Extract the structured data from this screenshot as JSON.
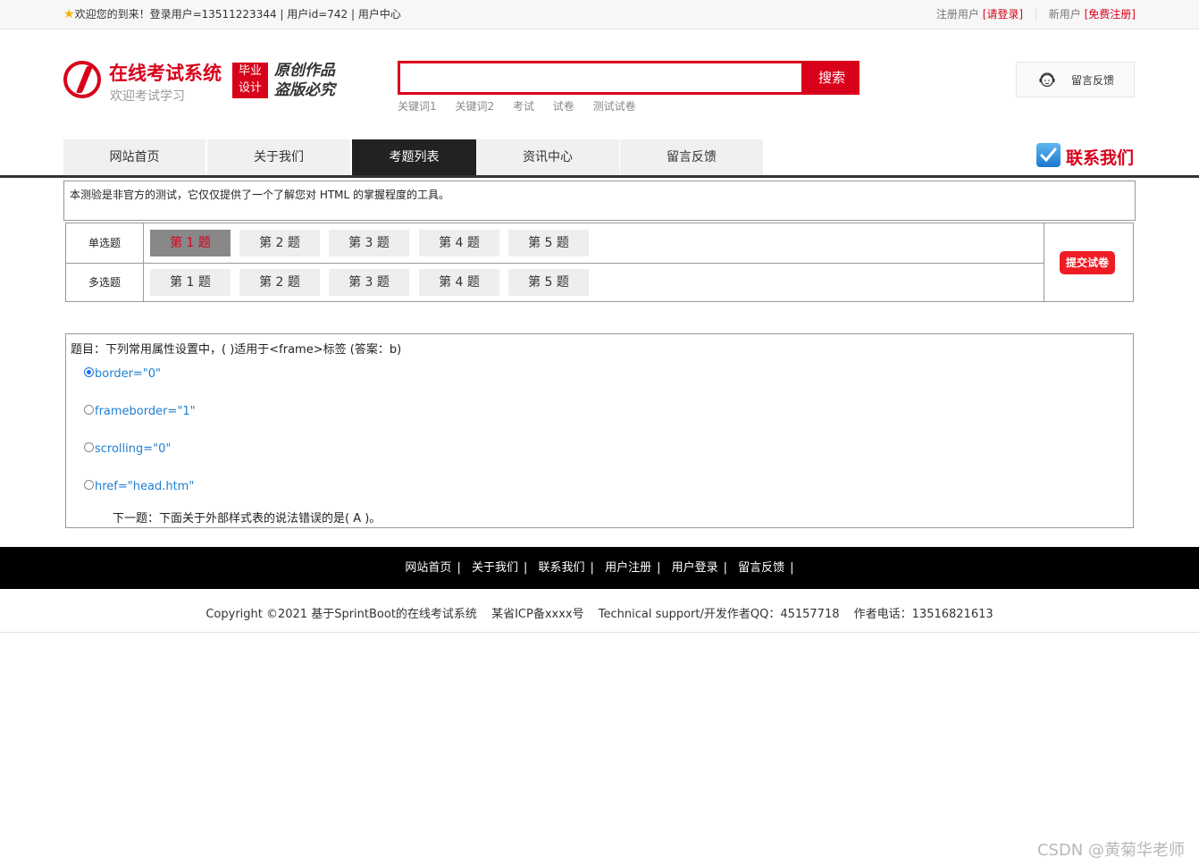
{
  "topbar": {
    "welcome": "欢迎您的到来！登录用户=13511223344 | 用户id=742 | 用户中心",
    "register_label": "注册用户",
    "login_link": "[请登录]",
    "new_user_label": "新用户",
    "signup_link": "[免费注册]"
  },
  "header": {
    "logo_title": "在线考试系统",
    "logo_subtitle": "欢迎考试学习",
    "badge_line1": "毕业",
    "badge_line2": "设计",
    "slogan_line1": "原创作品",
    "slogan_line2": "盗版必究",
    "search_placeholder": "",
    "search_button": "搜索",
    "hot_words": [
      "关键词1",
      "关键词2",
      "考试",
      "试卷",
      "测试试卷"
    ],
    "feedback_label": "留言反馈"
  },
  "nav": {
    "items": [
      "网站首页",
      "关于我们",
      "考题列表",
      "资讯中心",
      "留言反馈"
    ],
    "active_index": 2,
    "contact_label": "联系我们"
  },
  "notice": "本测验是非官方的测试，它仅仅提供了一个了解您对 HTML 的掌握程度的工具。",
  "question_nav": {
    "single_label": "单选题",
    "multi_label": "多选题",
    "single_items": [
      "第 1 题",
      "第 2 题",
      "第 3 题",
      "第 4 题",
      "第 5 题"
    ],
    "multi_items": [
      "第 1 题",
      "第 2 题",
      "第 3 题",
      "第 4 题",
      "第 5 题"
    ],
    "current": "single-1",
    "submit_button": "提交试卷"
  },
  "question": {
    "title": "题目：下列常用属性设置中，( )适用于<frame>标签 (答案：b)",
    "options": [
      "border=\"0\"",
      "frameborder=\"1\"",
      "scrolling=\"0\"",
      "href=\"head.htm\""
    ],
    "selected_index": 0,
    "next": "下一题：下面关于外部样式表的说法错误的是( A )。"
  },
  "footer": {
    "links": [
      "网站首页",
      "关于我们",
      "联系我们",
      "用户注册",
      "用户登录",
      "留言反馈"
    ],
    "copyright": "Copyright ©2021 基于SprintBoot的在线考试系统",
    "icp": "某省ICP备xxxx号",
    "support": "Technical support/开发作者QQ：45157718",
    "phone": "作者电话：13516821613"
  },
  "watermark": "CSDN @黄菊华老师",
  "colors": {
    "brand_red": "#d9001b",
    "nav_active": "#222222",
    "option_blue": "#1e7fd0"
  }
}
